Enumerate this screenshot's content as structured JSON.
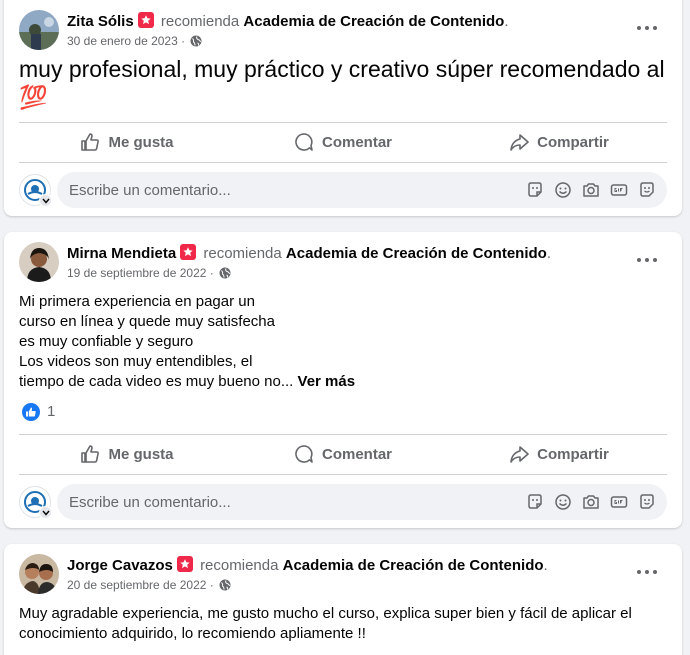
{
  "common": {
    "recommends": "recomienda",
    "page_name": "Academia de Creación de Contenido",
    "period": ".",
    "date_sep": " · ",
    "like_label": "Me gusta",
    "comment_label": "Comentar",
    "share_label": "Compartir",
    "comment_placeholder": "Escribe un comentario...",
    "see_more": "Ver más",
    "accent": "#1877f2",
    "recommend_badge_color": "#f02849"
  },
  "posts": [
    {
      "author": "Zita Sólis",
      "date": "30 de enero de 2023",
      "text": "muy profesional, muy práctico y creativo súper recomendado al",
      "emoji": "💯"
    },
    {
      "author": "Mirna Mendieta",
      "date": "19 de septiembre de 2022",
      "lines": [
        "Mi primera experiencia en pagar un",
        "curso en línea y quede muy satisfecha",
        "es muy confiable y seguro",
        "Los videos son muy entendibles, el",
        "tiempo de cada video es muy bueno no..."
      ],
      "reaction_count": "1"
    },
    {
      "author": "Jorge Cavazos",
      "date": "20 de septiembre de 2022",
      "text": "Muy agradable experiencia, me gusto mucho el curso, explica super bien y fácil de aplicar el conocimiento adquirido, lo recomiendo apliamente !!"
    }
  ]
}
